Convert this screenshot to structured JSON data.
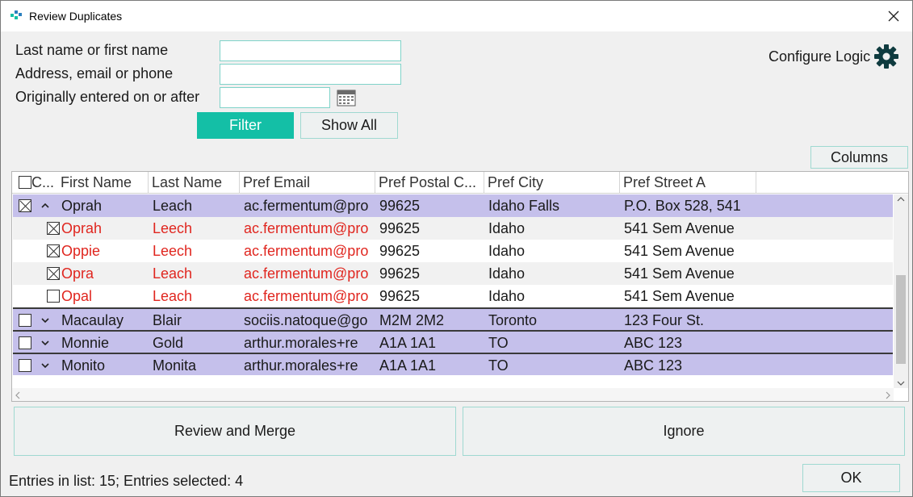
{
  "window": {
    "title": "Review Duplicates",
    "close_glyph": "✕"
  },
  "filters": {
    "name_label": "Last name or first name",
    "name_value": "",
    "contact_label": "Address, email or phone",
    "contact_value": "",
    "date_label": "Originally entered on or after",
    "date_value": "",
    "filter_button": "Filter",
    "show_all_button": "Show All"
  },
  "configure_logic": "Configure Logic",
  "columns_button": "Columns",
  "table": {
    "headers": [
      "C...",
      "First Name",
      "Last Name",
      "Pref Email",
      "Pref Postal C...",
      "Pref City",
      "Pref Street A"
    ],
    "rows": [
      {
        "kind": "parent",
        "checked": true,
        "expanded": true,
        "first": "Oprah",
        "last": "Leach",
        "email": "ac.fermentum@pro",
        "postal": "99625",
        "city": "Idaho Falls",
        "street": "P.O. Box 528, 541"
      },
      {
        "kind": "child",
        "checked": true,
        "first": "Oprah",
        "last": "Leech",
        "email": "ac.fermentum@pro",
        "postal": "99625",
        "city": "Idaho",
        "street": "541 Sem Avenue"
      },
      {
        "kind": "child",
        "checked": true,
        "first": "Oppie",
        "last": "Leech",
        "email": "ac.fermentum@pro",
        "postal": "99625",
        "city": "Idaho",
        "street": "541 Sem Avenue"
      },
      {
        "kind": "child",
        "checked": true,
        "first": "Opra",
        "last": "Leach",
        "email": "ac.fermentum@pro",
        "postal": "99625",
        "city": "Idaho",
        "street": "541 Sem Avenue"
      },
      {
        "kind": "child",
        "checked": false,
        "first": "Opal",
        "last": "Leach",
        "email": "ac.fermentum@pro",
        "postal": "99625",
        "city": "Idaho",
        "street": "541 Sem Avenue"
      },
      {
        "kind": "parent",
        "checked": false,
        "expanded": false,
        "first": "Macaulay",
        "last": "Blair",
        "email": "sociis.natoque@go",
        "postal": "M2M 2M2",
        "city": "Toronto",
        "street": "123 Four St."
      },
      {
        "kind": "parent",
        "checked": false,
        "expanded": false,
        "first": "Monnie",
        "last": "Gold",
        "email": "arthur.morales+re",
        "postal": "A1A 1A1",
        "city": "TO",
        "street": "ABC 123"
      },
      {
        "kind": "parent",
        "checked": false,
        "expanded": false,
        "first": "Monito",
        "last": "Monita",
        "email": "arthur.morales+re",
        "postal": "A1A 1A1",
        "city": "TO",
        "street": "ABC 123"
      }
    ]
  },
  "actions": {
    "review_merge": "Review and Merge",
    "ignore": "Ignore",
    "ok": "OK"
  },
  "status": "Entries in list: 15; Entries selected: 4",
  "colors": {
    "accent": "#14bfa6",
    "group_row": "#c5c0eb",
    "duplicate_text": "#e0261f"
  }
}
